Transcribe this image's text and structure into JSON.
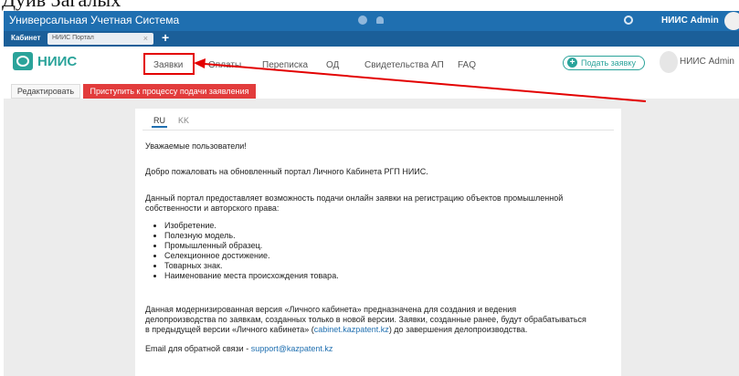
{
  "caption": "Дуйв Загалых",
  "app_bar": {
    "title": "Универсальная Учетная Система",
    "user": "НИИС Admin"
  },
  "tabs": {
    "cabinet": "Кабинет",
    "portal": "НИИС Портал",
    "close": "×",
    "add": "+"
  },
  "nav": {
    "logo": "НИИС",
    "items": [
      "Заявки",
      "Оплаты",
      "Переписка",
      "ОД",
      "Свидетельства АП",
      "FAQ"
    ],
    "apply_button": "Подать заявку",
    "user": "НИИС Admin"
  },
  "toolbar": {
    "edit": "Редактировать",
    "start": "Приступить к процессу подачи заявления"
  },
  "content": {
    "lang_tabs": [
      "RU",
      "KK"
    ],
    "greeting": "Уважаемые пользователи!",
    "welcome": "Добро пожаловать на обновленный портал Личного Кабинета РГП НИИС.",
    "intro_1": "Данный портал предоставляет возможность подачи онлайн заявки на регистрацию объектов промышленной",
    "intro_2": "собственности и авторского права:",
    "bullets": [
      "Изобретение.",
      "Полезную модель.",
      "Промышленный образец.",
      "Селекционное достижение.",
      "Товарных знак.",
      "Наименование места происхождения товара."
    ],
    "note_1": "Данная модернизированная версия «Личного кабинета» предназначена для создания и ведения",
    "note_2": "делопроизводства по заявкам, созданных только в новой версии. Заявки, созданные ранее, будут обрабатываться",
    "note_3_pre": "в предыдущей версии «Личного кабинета» (",
    "note_3_link": "cabinet.kazpatent.kz",
    "note_3_post": ") до завершения делопроизводства.",
    "email_label": "Email для обратной связи - ",
    "email_link": "support@kazpatent.kz"
  },
  "colors": {
    "header": "#1f6fb0",
    "tabbar": "#1b5f99",
    "brand": "#2aa39a",
    "danger": "#e23c3c",
    "annotation": "#e30000"
  }
}
